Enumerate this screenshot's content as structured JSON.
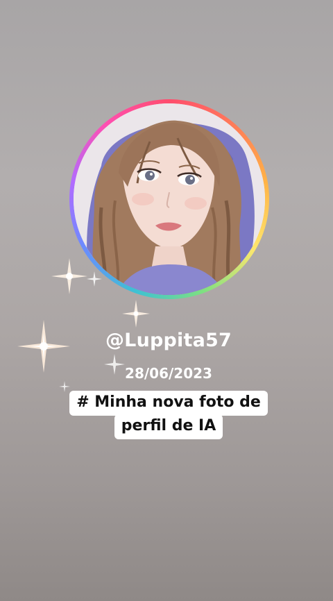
{
  "profile": {
    "username": "@Luppita57",
    "date": "28/06/2023",
    "caption_line_1": "# Minha nova foto de",
    "caption_line_2": "perfil de IA",
    "avatar_description_icon": "anime-girl-avatar"
  },
  "colors": {
    "background_top": "#a8a5a6",
    "background_bottom": "#8f8987",
    "ring_gradient": [
      "#ff4d6d",
      "#ffb347",
      "#ffe66d",
      "#7ee081",
      "#3ec1d3",
      "#6a8cff",
      "#b26bff",
      "#ff4fb1"
    ],
    "text": "#ffffff",
    "caption_bg": "#ffffff",
    "caption_text": "#111111"
  },
  "decorations": {
    "sparkle_icon": "sparkle-icon"
  }
}
